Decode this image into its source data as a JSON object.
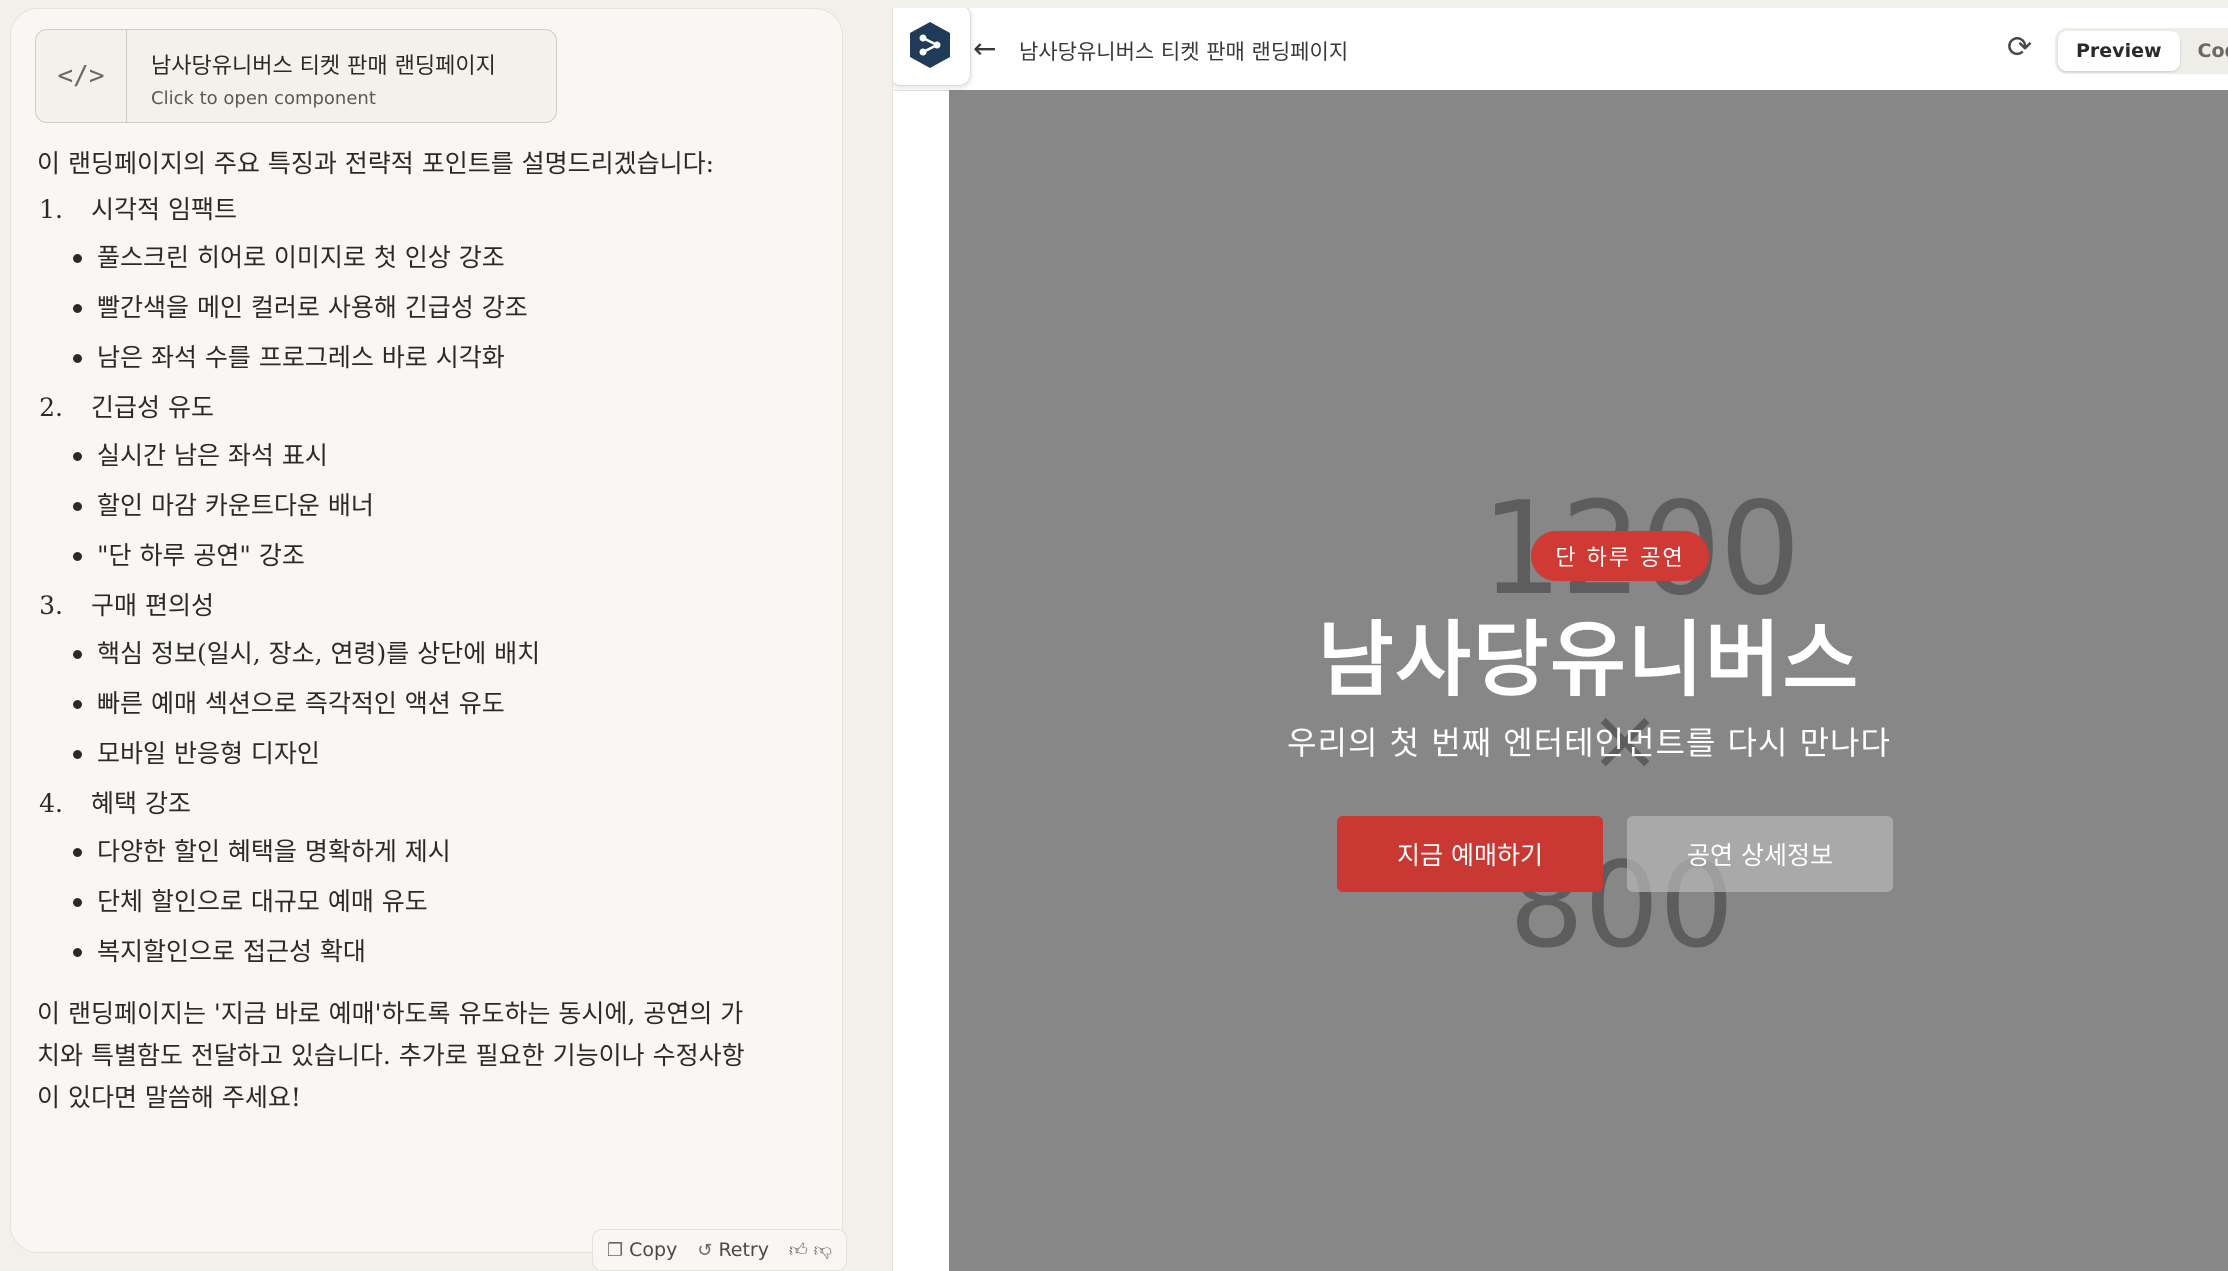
{
  "artifact_card": {
    "title": "남사당유니버스 티켓 판매 랜딩페이지",
    "subtitle": "Click to open component",
    "icon": "code-icon"
  },
  "message": {
    "intro": "이 랜딩페이지의 주요 특징과 전략적 포인트를 설명드리겠습니다:",
    "sections": [
      {
        "number": "1.",
        "heading": "시각적 임팩트",
        "bullets": [
          "풀스크린 히어로 이미지로 첫 인상 강조",
          "빨간색을 메인 컬러로 사용해 긴급성 강조",
          "남은 좌석 수를 프로그레스 바로 시각화"
        ]
      },
      {
        "number": "2.",
        "heading": "긴급성 유도",
        "bullets": [
          "실시간 남은 좌석 표시",
          "할인 마감 카운트다운 배너",
          "\"단 하루 공연\" 강조"
        ]
      },
      {
        "number": "3.",
        "heading": "구매 편의성",
        "bullets": [
          "핵심 정보(일시, 장소, 연령)를 상단에 배치",
          "빠른 예매 섹션으로 즉각적인 액션 유도",
          "모바일 반응형 디자인"
        ]
      },
      {
        "number": "4.",
        "heading": "혜택 강조",
        "bullets": [
          "다양한 할인 혜택을 명확하게 제시",
          "단체 할인으로 대규모 예매 유도",
          "복지할인으로 접근성 확대"
        ]
      }
    ],
    "outro": "이 랜딩페이지는 '지금 바로 예매'하도록 유도하는 동시에, 공연의 가치와 특별함도 전달하고 있습니다. 추가로 필요한 기능이나 수정사항이 있다면 말씀해 주세요!"
  },
  "actions": {
    "copy": "Copy",
    "retry": "Retry"
  },
  "panel": {
    "title": "남사당유니버스 티켓 판매 랜딩페이지",
    "tabs": {
      "preview": "Preview",
      "code": "Code"
    }
  },
  "preview": {
    "bg_top": "1200",
    "bg_mid": "×",
    "bg_bottom": "800",
    "badge": "단 하루 공연",
    "title": "남사당유니버스",
    "subtitle": "우리의 첫 번째 엔터테인먼트를 다시 만나다",
    "primary_button": "지금 예매하기",
    "secondary_button": "공연 상세정보",
    "colors": {
      "accent": "#c93832",
      "background": "#878787"
    }
  }
}
